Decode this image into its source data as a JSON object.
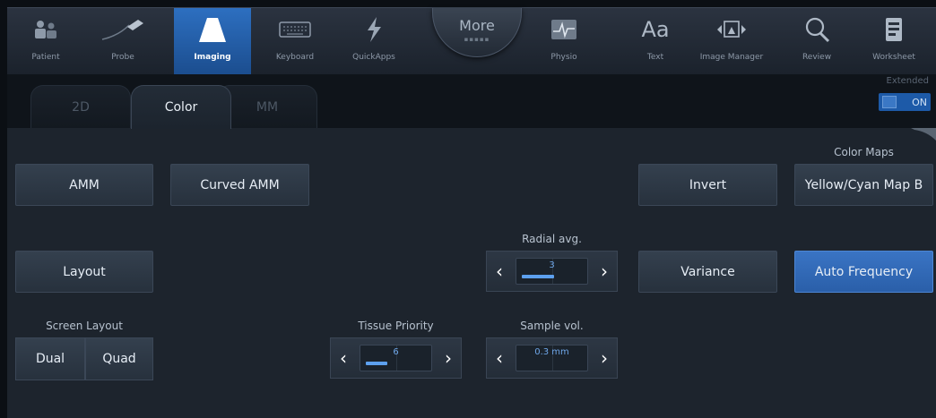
{
  "toolbar": {
    "items": [
      {
        "label": "Patient",
        "icon": "patient-icon"
      },
      {
        "label": "Probe",
        "icon": "probe-icon"
      },
      {
        "label": "Imaging",
        "icon": "imaging-icon",
        "active": true
      },
      {
        "label": "Keyboard",
        "icon": "keyboard-icon"
      },
      {
        "label": "QuickApps",
        "icon": "quickapps-icon"
      },
      {
        "label": "Physio",
        "icon": "physio-icon"
      },
      {
        "label": "Text",
        "icon": "text-icon"
      },
      {
        "label": "Image Manager",
        "icon": "image-manager-icon"
      },
      {
        "label": "Review",
        "icon": "review-icon"
      },
      {
        "label": "Worksheet",
        "icon": "worksheet-icon"
      }
    ],
    "more_label": "More",
    "text_glyph": "Aa"
  },
  "tabs": [
    {
      "label": "2D",
      "active": false
    },
    {
      "label": "Color",
      "active": true
    },
    {
      "label": "MM",
      "active": false
    }
  ],
  "extended": {
    "label": "Extended",
    "state": "ON"
  },
  "controls": {
    "amm": "AMM",
    "curved_amm": "Curved AMM",
    "invert": "Invert",
    "color_maps_caption": "Color Maps",
    "color_map": "Yellow/Cyan Map B",
    "layout": "Layout",
    "variance": "Variance",
    "auto_frequency": "Auto Frequency",
    "screen_layout_caption": "Screen Layout",
    "dual": "Dual",
    "quad": "Quad",
    "radial_avg": {
      "caption": "Radial avg.",
      "value": "3",
      "level": 0.45
    },
    "tissue_priority": {
      "caption": "Tissue Priority",
      "value": "6",
      "level": 0.3
    },
    "sample_vol": {
      "caption": "Sample vol.",
      "value": "0.3 mm"
    }
  },
  "colors": {
    "accent": "#2a62b0",
    "panel": "#1d242d",
    "active_tab_text": "#e8eef5"
  }
}
